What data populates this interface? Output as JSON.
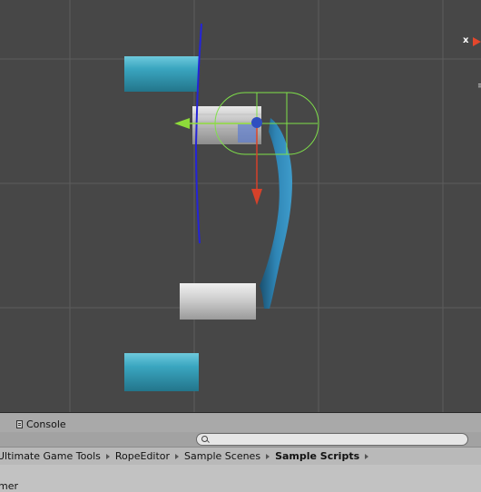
{
  "scene": {
    "gizmo_axis_label": "x",
    "gizmo_menu_glyph": "≡"
  },
  "console_tab": {
    "label": "Console",
    "icon": "console-icon"
  },
  "search": {
    "placeholder": "",
    "icon": "search-icon"
  },
  "breadcrumb": {
    "items": [
      "Ultimate Game Tools",
      "RopeEditor",
      "Sample Scenes",
      "Sample Scripts"
    ],
    "bold_index": 3
  },
  "project_list": {
    "partial_item": "mer"
  },
  "colors": {
    "scene_background": "#474747",
    "grid_line": "#5a5a5a",
    "cylinder_cyan": "#3aa0ba",
    "rope_blue": "#2f7fae",
    "axis_y_green": "#8ddb3a",
    "axis_z_red": "#d6412a",
    "axis_x_blue": "#2a2ad8",
    "gizmo_center": "#2f4fc0"
  }
}
